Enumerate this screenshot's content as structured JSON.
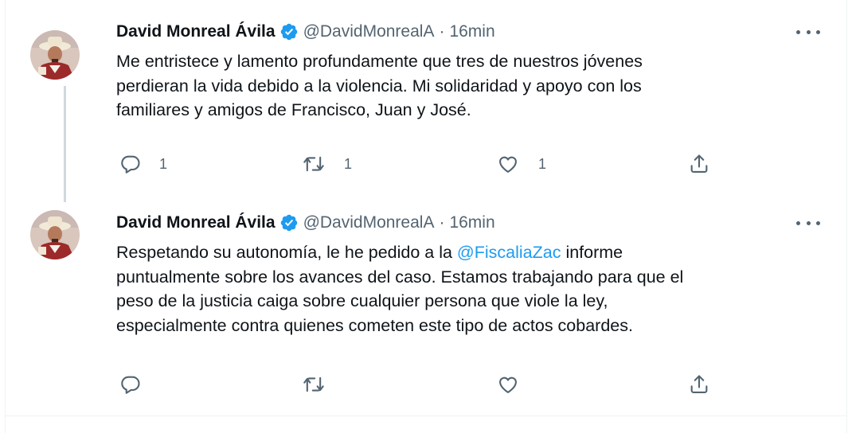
{
  "tweets": [
    {
      "author_name": "David Monreal Ávila",
      "handle": "@DavidMonrealA",
      "separator": "·",
      "time": "16min",
      "text_lines": [
        "Me entristece y lamento profundamente que tres de nuestros jóvenes",
        "perdieran la vida debido a la violencia. Mi solidaridad y apoyo con los",
        "familiares y amigos de Francisco, Juan y José."
      ],
      "replies": "1",
      "retweets": "1",
      "likes": "1",
      "avatar_icon": "avatar-photo-icon"
    },
    {
      "author_name": "David Monreal Ávila",
      "handle": "@DavidMonrealA",
      "separator": "·",
      "time": "16min",
      "text_line1_before": "Respetando su autonomía, le he pedido a la ",
      "mention": "@FiscaliaZac",
      "text_line1_after": " informe",
      "text_lines_rest": [
        "puntualmente sobre los avances del caso. Estamos trabajando para que el",
        "peso de la justicia caiga sobre cualquier persona que viole la ley,",
        "especialmente contra quienes cometen este tipo de actos cobardes."
      ],
      "avatar_icon": "avatar-photo-icon"
    }
  ],
  "icons": {
    "verified": "verified-badge-icon",
    "more": "more-options-icon",
    "reply": "reply-icon",
    "retweet": "retweet-icon",
    "like": "heart-icon",
    "share": "share-icon"
  },
  "colors": {
    "text": "#0f1419",
    "secondary": "#536471",
    "accent": "#1d9bf0",
    "border": "#eff3f4",
    "thread_line": "#cfd9de"
  }
}
